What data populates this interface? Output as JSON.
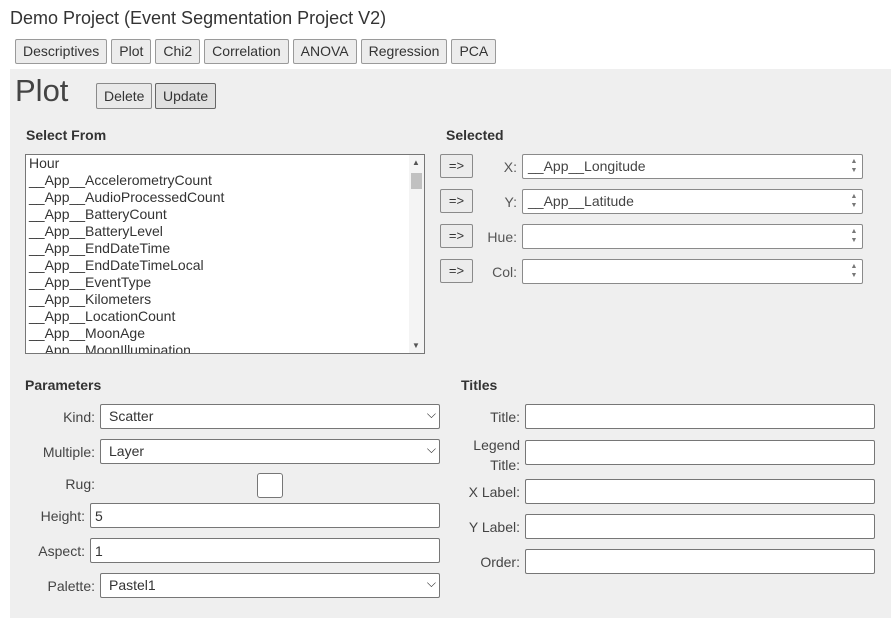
{
  "project_title": "Demo Project (Event Segmentation Project V2)",
  "tabs": [
    "Descriptives",
    "Plot",
    "Chi2",
    "Correlation",
    "ANOVA",
    "Regression",
    "PCA"
  ],
  "page_heading": "Plot",
  "actions": {
    "delete_label": "Delete",
    "update_label": "Update"
  },
  "select_from": {
    "title": "Select From",
    "items": [
      "Hour",
      "__App__AccelerometryCount",
      "__App__AudioProcessedCount",
      "__App__BatteryCount",
      "__App__BatteryLevel",
      "__App__EndDateTime",
      "__App__EndDateTimeLocal",
      "__App__EventType",
      "__App__Kilometers",
      "__App__LocationCount",
      "__App__MoonAge",
      "__App__MoonIllumination"
    ]
  },
  "selected": {
    "title": "Selected",
    "move_label": "=>",
    "rows": [
      {
        "label": "X:",
        "value": "__App__Longitude"
      },
      {
        "label": "Y:",
        "value": "__App__Latitude"
      },
      {
        "label": "Hue:",
        "value": ""
      },
      {
        "label": "Col:",
        "value": ""
      }
    ]
  },
  "parameters": {
    "title": "Parameters",
    "kind_label": "Kind:",
    "kind_value": "Scatter",
    "multiple_label": "Multiple:",
    "multiple_value": "Layer",
    "rug_label": "Rug:",
    "height_label": "Height:",
    "height_value": "5",
    "aspect_label": "Aspect:",
    "aspect_value": "1",
    "palette_label": "Palette:",
    "palette_value": "Pastel1"
  },
  "titles": {
    "title": "Titles",
    "title_label": "Title:",
    "legend_label_line1": "Legend",
    "legend_label_line2": "Title:",
    "xlabel_label": "X Label:",
    "ylabel_label": "Y Label:",
    "order_label": "Order:"
  }
}
